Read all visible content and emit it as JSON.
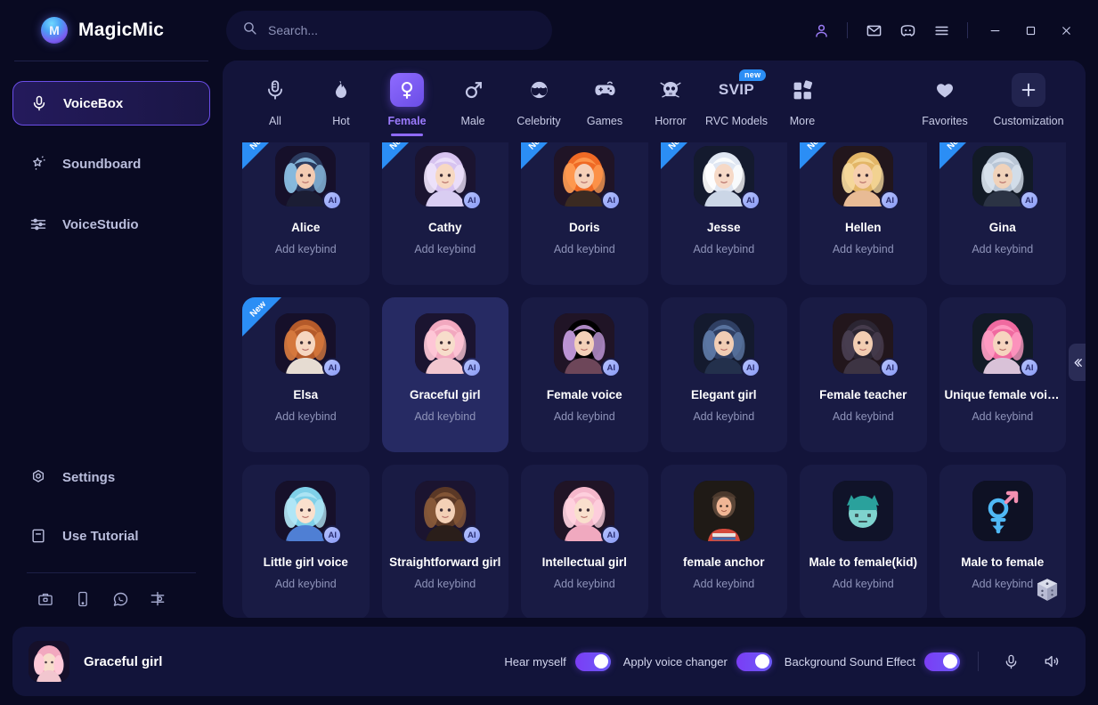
{
  "app": {
    "brand": "MagicMic",
    "logo_icon": "magicmic-logo-icon"
  },
  "search": {
    "placeholder": "Search...",
    "value": "",
    "icon": "search-icon"
  },
  "titlebar": {
    "account_icon": "user-account-icon",
    "mail_icon": "mail-icon",
    "discord_icon": "discord-icon",
    "menu_icon": "hamburger-menu-icon",
    "minimize_icon": "minimize-icon",
    "maximize_icon": "maximize-icon",
    "close_icon": "close-icon"
  },
  "sidebar": {
    "items": [
      {
        "label": "VoiceBox",
        "icon": "microphone-icon",
        "active": true
      },
      {
        "label": "Soundboard",
        "icon": "magic-wand-icon",
        "active": false
      },
      {
        "label": "VoiceStudio",
        "icon": "sliders-icon",
        "active": false
      }
    ],
    "bottom_items": [
      {
        "label": "Settings",
        "icon": "gear-icon"
      },
      {
        "label": "Use Tutorial",
        "icon": "book-icon"
      }
    ],
    "social": [
      {
        "icon": "briefcase-icon"
      },
      {
        "icon": "mobile-phone-icon"
      },
      {
        "icon": "whatsapp-icon"
      },
      {
        "icon": "share-network-icon"
      }
    ]
  },
  "tabs": {
    "items": [
      {
        "label": "All",
        "icon": "microphone-all-icon",
        "active": false,
        "badge": ""
      },
      {
        "label": "Hot",
        "icon": "flame-icon",
        "active": false,
        "badge": ""
      },
      {
        "label": "Female",
        "icon": "venus-female-icon",
        "active": true,
        "badge": ""
      },
      {
        "label": "Male",
        "icon": "mars-male-icon",
        "active": false,
        "badge": ""
      },
      {
        "label": "Celebrity",
        "icon": "sunglasses-icon",
        "active": false,
        "badge": ""
      },
      {
        "label": "Games",
        "icon": "gamepad-icon",
        "active": false,
        "badge": ""
      },
      {
        "label": "Horror",
        "icon": "skull-icon",
        "active": false,
        "badge": ""
      },
      {
        "label": "RVC Models",
        "icon": "svip-text-icon",
        "active": false,
        "badge": "new"
      },
      {
        "label": "More",
        "icon": "grid-squares-icon",
        "active": false,
        "badge": ""
      }
    ],
    "right_items": [
      {
        "label": "Favorites",
        "icon": "heart-icon"
      },
      {
        "label": "Customization",
        "icon": "plus-icon"
      }
    ]
  },
  "content": {
    "section_title": "Female",
    "keybind_label": "Add keybind",
    "new_badge": "New",
    "ai_badge": "AI",
    "collapse_icon": "chevron-double-left-icon",
    "random_icon": "dice-icon",
    "cards": [
      {
        "name": "Alice",
        "is_new": true,
        "ai": true,
        "selected": false,
        "hair": "#2b3a5e",
        "hair2": "#8fc4e8",
        "skin": "#f3cbb2",
        "cloth": "#1b1d34"
      },
      {
        "name": "Cathy",
        "is_new": true,
        "ai": true,
        "selected": false,
        "hair": "#d7c3f0",
        "hair2": "#efe4fb",
        "skin": "#f7d8c2",
        "cloth": "#d9cdf2"
      },
      {
        "name": "Doris",
        "is_new": true,
        "ai": true,
        "selected": false,
        "hair": "#ef6a25",
        "hair2": "#ff9c52",
        "skin": "#f5d0b8",
        "cloth": "#3a2a22"
      },
      {
        "name": "Jesse",
        "is_new": true,
        "ai": true,
        "selected": false,
        "hair": "#dfe6f2",
        "hair2": "#ffffff",
        "skin": "#f6d9c7",
        "cloth": "#cbd6e6"
      },
      {
        "name": "Hellen",
        "is_new": true,
        "ai": true,
        "selected": false,
        "hair": "#e3b667",
        "hair2": "#f6da9e",
        "skin": "#f6cfae",
        "cloth": "#e8bb95"
      },
      {
        "name": "Gina",
        "is_new": true,
        "ai": true,
        "selected": false,
        "hair": "#b9c6d6",
        "hair2": "#d9e3ee",
        "skin": "#f0d2ba",
        "cloth": "#2b3344"
      },
      {
        "name": "Elsa",
        "is_new": true,
        "ai": true,
        "selected": false,
        "hair": "#b45a2a",
        "hair2": "#d87b3f",
        "skin": "#f6d6c0",
        "cloth": "#e6dcd2"
      },
      {
        "name": "Graceful girl",
        "is_new": false,
        "ai": true,
        "selected": true,
        "hair": "#f2a8bf",
        "hair2": "#ffc9d8",
        "skin": "#f7ddcb",
        "cloth": "#f2c6cf"
      },
      {
        "name": "Female voice",
        "is_new": false,
        "ai": true,
        "selected": false,
        "hair": "#a濃",
        "hair2": "#caa0e4",
        "skin": "#f3d0b8",
        "cloth": "#6d4659"
      },
      {
        "name": "Elegant girl",
        "is_new": false,
        "ai": true,
        "selected": false,
        "hair": "#2f3f63",
        "hair2": "#5f7ba8",
        "skin": "#f1cdb4",
        "cloth": "#23304c"
      },
      {
        "name": "Female teacher",
        "is_new": false,
        "ai": true,
        "selected": false,
        "hair": "#2b2532",
        "hair2": "#4a3f51",
        "skin": "#f2cdb2",
        "cloth": "#3d3443"
      },
      {
        "name": "Unique female voice",
        "is_new": false,
        "ai": true,
        "selected": false,
        "hair": "#f06aa0",
        "hair2": "#ff9ec4",
        "skin": "#f6d4bf",
        "cloth": "#d9c2d8"
      },
      {
        "name": "Little girl voice",
        "is_new": false,
        "ai": true,
        "selected": false,
        "hair": "#7fd0e8",
        "hair2": "#b4e7f6",
        "skin": "#fae0cd",
        "cloth": "#4f7fd4"
      },
      {
        "name": "Straightforward girl",
        "is_new": false,
        "ai": true,
        "selected": false,
        "hair": "#5a3826",
        "hair2": "#8a5b3a",
        "skin": "#f3d0b6",
        "cloth": "#2a1e1a"
      },
      {
        "name": "Intellectual girl",
        "is_new": false,
        "ai": true,
        "selected": false,
        "hair": "#f5b7cb",
        "hair2": "#ffd3e0",
        "skin": "#f9dfcd",
        "cloth": "#f0a9bf"
      },
      {
        "name": "female anchor",
        "is_new": false,
        "ai": false,
        "selected": false,
        "hair": "#5b4638",
        "hair2": "#7a5f4a",
        "skin": "#f0b695",
        "cloth": "#d44a3c"
      },
      {
        "name": "Male to female(kid)",
        "is_new": false,
        "ai": false,
        "selected": false,
        "hair": "#2aa19c",
        "hair2": "#3fbdb7",
        "skin": "#7fd3ce",
        "cloth": "#2aa19c"
      },
      {
        "name": "Male to female",
        "is_new": false,
        "ai": false,
        "selected": false,
        "hair": "#4fb8f5",
        "hair2": "#f48fb1",
        "skin": "#4fb8f5",
        "cloth": "#4fb8f5"
      }
    ]
  },
  "player": {
    "current_voice": "Graceful girl",
    "controls": [
      {
        "label": "Hear myself",
        "on": true
      },
      {
        "label": "Apply voice changer",
        "on": true
      },
      {
        "label": "Background Sound Effect",
        "on": true
      }
    ],
    "mic_icon": "microphone-icon",
    "speaker_icon": "speaker-volume-icon"
  },
  "colors": {
    "accent": "#8f6bff",
    "badge_new": "#2b8ef5",
    "panel": "#13143a",
    "card": "#191b44",
    "card_selected": "#262a63",
    "background": "#090a22"
  }
}
